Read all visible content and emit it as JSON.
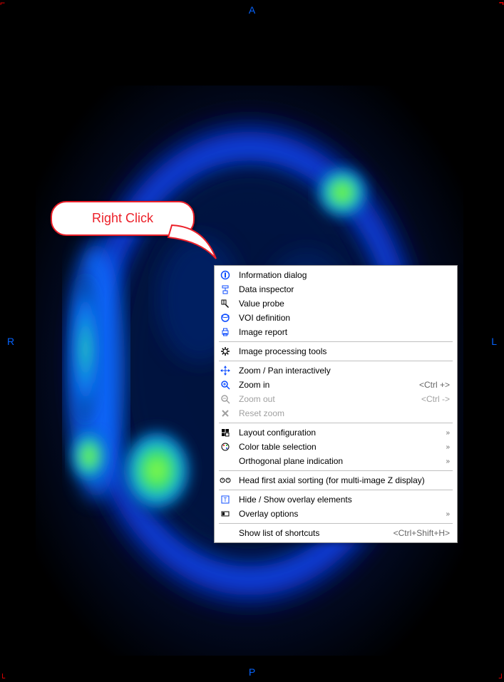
{
  "orientation": {
    "top": "A",
    "bottom": "P",
    "left": "R",
    "right": "L"
  },
  "callout": {
    "label": "Right Click"
  },
  "context_menu": {
    "groups": [
      [
        {
          "id": "info",
          "label": "Information dialog",
          "icon": "info-circle"
        },
        {
          "id": "inspect",
          "label": "Data inspector",
          "icon": "inspector"
        },
        {
          "id": "probe",
          "label": "Value probe",
          "icon": "probe"
        },
        {
          "id": "voi",
          "label": "VOI definition",
          "icon": "voi"
        },
        {
          "id": "report",
          "label": "Image report",
          "icon": "printer"
        }
      ],
      [
        {
          "id": "proc",
          "label": "Image processing tools",
          "icon": "gear"
        }
      ],
      [
        {
          "id": "zoompan",
          "label": "Zoom / Pan interactively",
          "icon": "crosshair"
        },
        {
          "id": "zin",
          "label": "Zoom in",
          "shortcut": "<Ctrl +>",
          "icon": "zoom-in"
        },
        {
          "id": "zout",
          "label": "Zoom out",
          "shortcut": "<Ctrl ->",
          "icon": "zoom-out",
          "disabled": true
        },
        {
          "id": "zrst",
          "label": "Reset zoom",
          "icon": "reset",
          "disabled": true
        }
      ],
      [
        {
          "id": "layout",
          "label": "Layout configuration",
          "icon": "layout",
          "submenu": true
        },
        {
          "id": "ctable",
          "label": "Color table selection",
          "icon": "palette",
          "submenu": true
        },
        {
          "id": "ortho",
          "label": "Orthogonal plane indication",
          "submenu": true
        }
      ],
      [
        {
          "id": "hfaxial",
          "label": "Head first axial sorting (for multi-image Z display)",
          "icon": "head-axial"
        }
      ],
      [
        {
          "id": "overlay",
          "label": "Hide / Show overlay elements",
          "icon": "overlay-toggle"
        },
        {
          "id": "ovlopt",
          "label": "Overlay options",
          "icon": "overlay-opt",
          "submenu": true
        }
      ],
      [
        {
          "id": "shorts",
          "label": "Show list of shortcuts",
          "shortcut": "<Ctrl+Shift+H>"
        }
      ]
    ]
  },
  "colors": {
    "accent": "#0b4bff"
  }
}
